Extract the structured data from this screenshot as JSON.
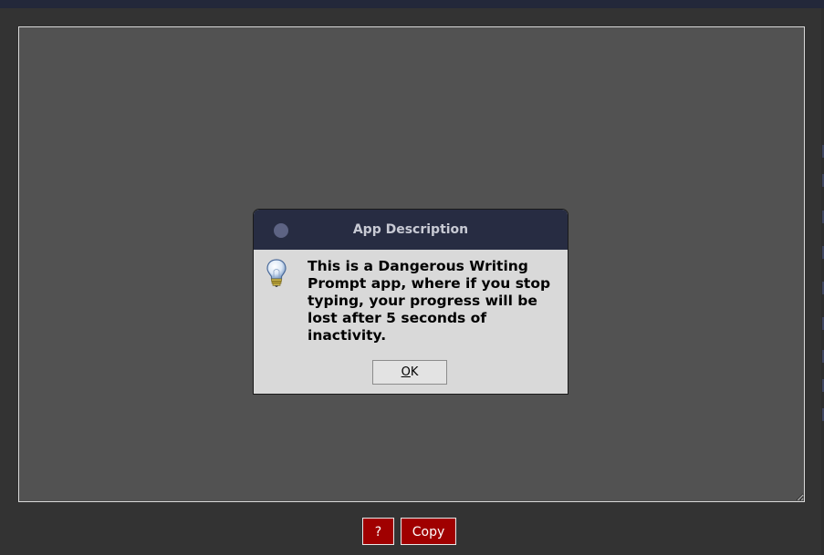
{
  "editor": {
    "text": ""
  },
  "buttons": {
    "help_label": "?",
    "copy_label": "Copy"
  },
  "dialog": {
    "title": "App Description",
    "message": "This is a Dangerous Writing\nPrompt app, where if you stop\ntyping, your progress will be\nlost after 5 seconds of\ninactivity.",
    "ok_mnemonic": "O",
    "ok_rest": "K",
    "icon": "lightbulb-icon"
  },
  "colors": {
    "background": "#333333",
    "editor_background": "#525252",
    "button_red": "#a00000",
    "dialog_titlebar": "#272c42",
    "dialog_body": "#d9d9d9"
  }
}
